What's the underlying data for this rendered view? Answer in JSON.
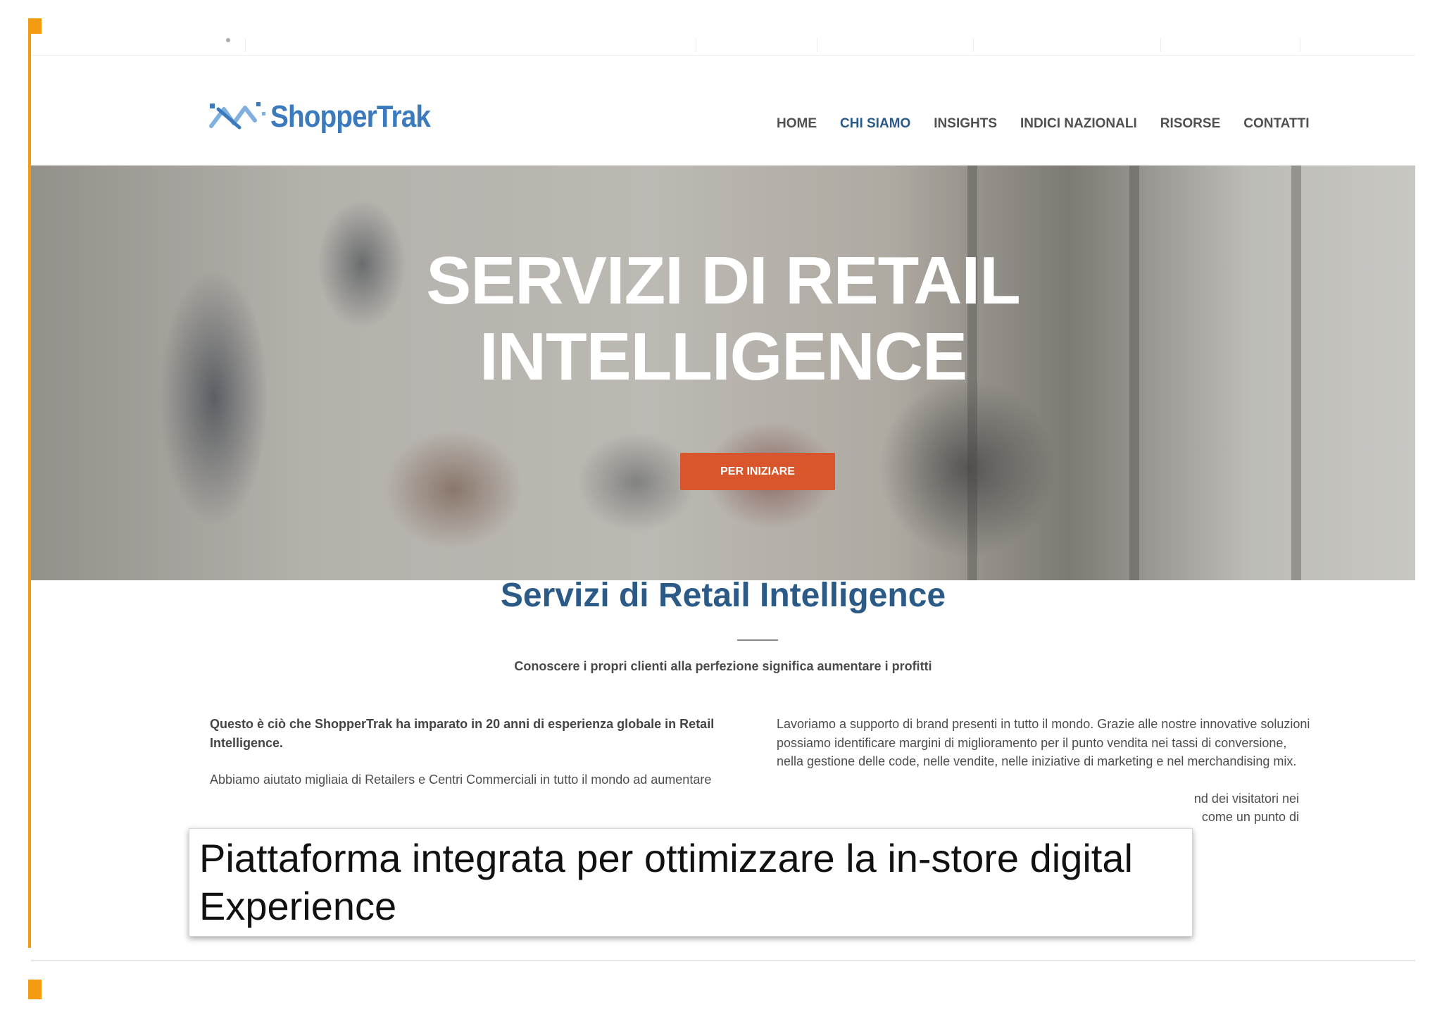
{
  "site": {
    "logo_text": "ShopperTrak",
    "nav": [
      {
        "label": "HOME",
        "active": false
      },
      {
        "label": "CHI SIAMO",
        "active": true
      },
      {
        "label": "INSIGHTS",
        "active": false
      },
      {
        "label": "INDICI NAZIONALI",
        "active": false
      },
      {
        "label": "RISORSE",
        "active": false
      },
      {
        "label": "CONTATTI",
        "active": false
      }
    ]
  },
  "hero": {
    "title_line1": "SERVIZI DI RETAIL",
    "title_line2": "INTELLIGENCE",
    "button_label": "PER INIZIARE"
  },
  "section": {
    "title": "Servizi di Retail Intelligence",
    "tagline": "Conoscere i propri clienti alla perfezione significa aumentare i profitti",
    "left_bold": "Questo è ciò che ShopperTrak ha imparato in 20 anni di esperienza globale in Retail Intelligence.",
    "left_text": "Abbiamo aiutato migliaia di Retailers e Centri Commerciali in tutto il mondo ad aumentare",
    "right_text": "Lavoriamo a supporto di brand presenti in tutto il mondo. Grazie alle nostre innovative soluzioni possiamo identificare margini di miglioramento per il punto vendita nei tassi di conversione, nella gestione delle code, nelle vendite, nelle iniziative di marketing e nel merchandising mix.",
    "right_partial_1": "nd dei visitatori nei",
    "right_partial_2": "come un punto di"
  },
  "caption": {
    "text": "Piattaforma integrata per ottimizzare la in-store digital Experience"
  },
  "colors": {
    "accent": "#f39c12",
    "brand_blue": "#2b5a87",
    "cta": "#d9552c"
  }
}
